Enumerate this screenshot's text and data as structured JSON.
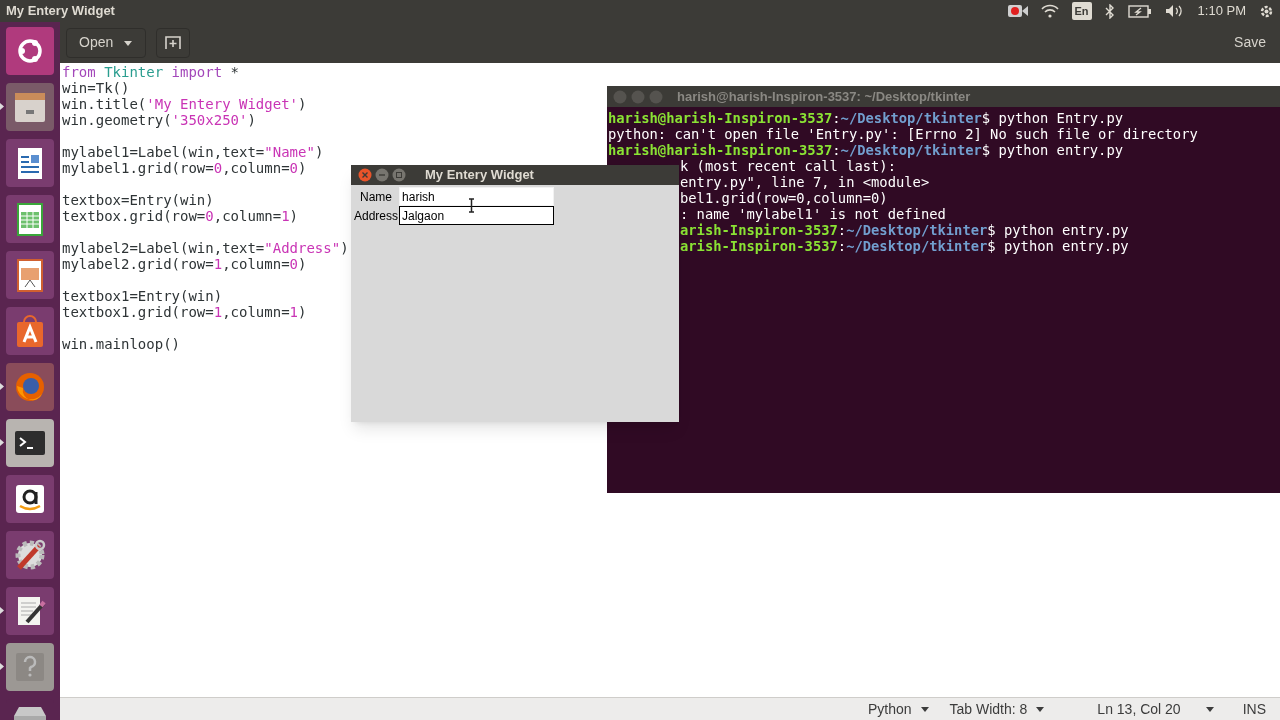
{
  "top_bar": {
    "title": "My Entery Widget",
    "language": "En",
    "time": "1:10 PM"
  },
  "launcher": [
    {
      "kind": "ubuntu",
      "running": false
    },
    {
      "kind": "files",
      "running": true
    },
    {
      "kind": "writer",
      "running": false
    },
    {
      "kind": "calc",
      "running": false
    },
    {
      "kind": "impress",
      "running": false
    },
    {
      "kind": "software",
      "running": false
    },
    {
      "kind": "firefox",
      "running": true
    },
    {
      "kind": "terminal",
      "running": true
    },
    {
      "kind": "amazon",
      "running": false
    },
    {
      "kind": "settings",
      "running": false
    },
    {
      "kind": "editor",
      "running": true
    },
    {
      "kind": "help",
      "running": true
    },
    {
      "kind": "drive",
      "running": false
    }
  ],
  "header": {
    "open_button": "Open",
    "save_button": "Save"
  },
  "editor": {
    "lines": [
      {
        "segments": [
          {
            "text": "from",
            "kind": "keyword"
          },
          {
            "text": " Tkinter ",
            "kind": "module"
          },
          {
            "text": "import",
            "kind": "keyword"
          },
          {
            "text": " *",
            "kind": "plain"
          }
        ]
      },
      {
        "segments": [
          {
            "text": "win=Tk()",
            "kind": "plain"
          }
        ]
      },
      {
        "segments": [
          {
            "text": "win.title(",
            "kind": "plain"
          },
          {
            "text": "'My Entery Widget'",
            "kind": "string"
          },
          {
            "text": ")",
            "kind": "plain"
          }
        ]
      },
      {
        "segments": [
          {
            "text": "win.geometry(",
            "kind": "plain"
          },
          {
            "text": "'350x250'",
            "kind": "string"
          },
          {
            "text": ")",
            "kind": "plain"
          }
        ]
      },
      {
        "blank": true
      },
      {
        "segments": [
          {
            "text": "mylabel1=Label(win,text=",
            "kind": "plain"
          },
          {
            "text": "\"Name\"",
            "kind": "string"
          },
          {
            "text": ")",
            "kind": "plain"
          }
        ]
      },
      {
        "segments": [
          {
            "text": "mylabel1.grid(row=",
            "kind": "plain"
          },
          {
            "text": "0",
            "kind": "number"
          },
          {
            "text": ",column=",
            "kind": "plain"
          },
          {
            "text": "0",
            "kind": "number"
          },
          {
            "text": ")",
            "kind": "plain"
          }
        ]
      },
      {
        "blank": true
      },
      {
        "segments": [
          {
            "text": "textbox=Entry(win)",
            "kind": "plain"
          }
        ]
      },
      {
        "segments": [
          {
            "text": "textbox.grid(row=",
            "kind": "plain"
          },
          {
            "text": "0",
            "kind": "number"
          },
          {
            "text": ",column=",
            "kind": "plain"
          },
          {
            "text": "1",
            "kind": "number"
          },
          {
            "text": ")",
            "kind": "plain"
          }
        ]
      },
      {
        "blank": true
      },
      {
        "segments": [
          {
            "text": "mylabel2=Label(win,text=",
            "kind": "plain"
          },
          {
            "text": "\"Address\"",
            "kind": "string"
          },
          {
            "text": ")",
            "kind": "plain"
          }
        ]
      },
      {
        "segments": [
          {
            "text": "mylabel2.grid(row=",
            "kind": "plain"
          },
          {
            "text": "1",
            "kind": "number"
          },
          {
            "text": ",column=",
            "kind": "plain"
          },
          {
            "text": "0",
            "kind": "number"
          },
          {
            "text": ")",
            "kind": "plain"
          }
        ]
      },
      {
        "blank": true
      },
      {
        "segments": [
          {
            "text": "textbox1=Entry(win)",
            "kind": "plain"
          }
        ]
      },
      {
        "segments": [
          {
            "text": "textbox1.grid(row=",
            "kind": "plain"
          },
          {
            "text": "1",
            "kind": "number"
          },
          {
            "text": ",column=",
            "kind": "plain"
          },
          {
            "text": "1",
            "kind": "number"
          },
          {
            "text": ")",
            "kind": "plain"
          }
        ]
      },
      {
        "blank": true
      },
      {
        "segments": [
          {
            "text": "win.mainloop()",
            "kind": "plain"
          }
        ]
      }
    ]
  },
  "status_bar": {
    "language": "Python",
    "tab_width": "Tab Width: 8",
    "position": "Ln 13, Col 20",
    "mode": "INS"
  },
  "terminal": {
    "title": "harish@harish-Inspiron-3537: ~/Desktop/tkinter",
    "lines": [
      {
        "clipped": false,
        "segments": [
          {
            "text": "harish@harish-Inspiron-3537",
            "kind": "user"
          },
          {
            "text": ":",
            "kind": "plain"
          },
          {
            "text": "~/Desktop/tkinter",
            "kind": "path"
          },
          {
            "text": "$ python Entry.py",
            "kind": "plain"
          }
        ]
      },
      {
        "clipped": false,
        "segments": [
          {
            "text": "python: can't open file 'Entry.py': [Errno 2] No such file or directory",
            "kind": "plain"
          }
        ]
      },
      {
        "clipped": false,
        "segments": [
          {
            "text": "harish@harish-Inspiron-3537",
            "kind": "user"
          },
          {
            "text": ":",
            "kind": "plain"
          },
          {
            "text": "~/Desktop/tkinter",
            "kind": "path"
          },
          {
            "text": "$ python entry.py",
            "kind": "plain"
          }
        ]
      },
      {
        "clipped": true,
        "segments": [
          {
            "text": "k (most recent call last):",
            "kind": "plain"
          }
        ]
      },
      {
        "clipped": true,
        "segments": [
          {
            "text": "entry.py\", line 7, in <module>",
            "kind": "plain"
          }
        ]
      },
      {
        "clipped": true,
        "segments": [
          {
            "text": "bel1.grid(row=0,column=0)",
            "kind": "plain"
          }
        ]
      },
      {
        "clipped": true,
        "segments": [
          {
            "text": ": name 'mylabel1' is not defined",
            "kind": "plain"
          }
        ]
      },
      {
        "clipped": true,
        "segments": [
          {
            "text": "arish-Inspiron-3537",
            "kind": "user"
          },
          {
            "text": ":",
            "kind": "plain"
          },
          {
            "text": "~/Desktop/tkinter",
            "kind": "path"
          },
          {
            "text": "$ python entry.py",
            "kind": "plain"
          }
        ]
      },
      {
        "clipped": true,
        "segments": [
          {
            "text": "arish-Inspiron-3537",
            "kind": "user"
          },
          {
            "text": ":",
            "kind": "plain"
          },
          {
            "text": "~/Desktop/tkinter",
            "kind": "path"
          },
          {
            "text": "$ python entry.py",
            "kind": "plain"
          }
        ]
      }
    ]
  },
  "tk_window": {
    "title": "My Entery Widget",
    "fields": [
      {
        "label": "Name",
        "value": "harish",
        "focused": false
      },
      {
        "label": "Address",
        "value": "Jalgaon",
        "focused": true
      }
    ]
  }
}
